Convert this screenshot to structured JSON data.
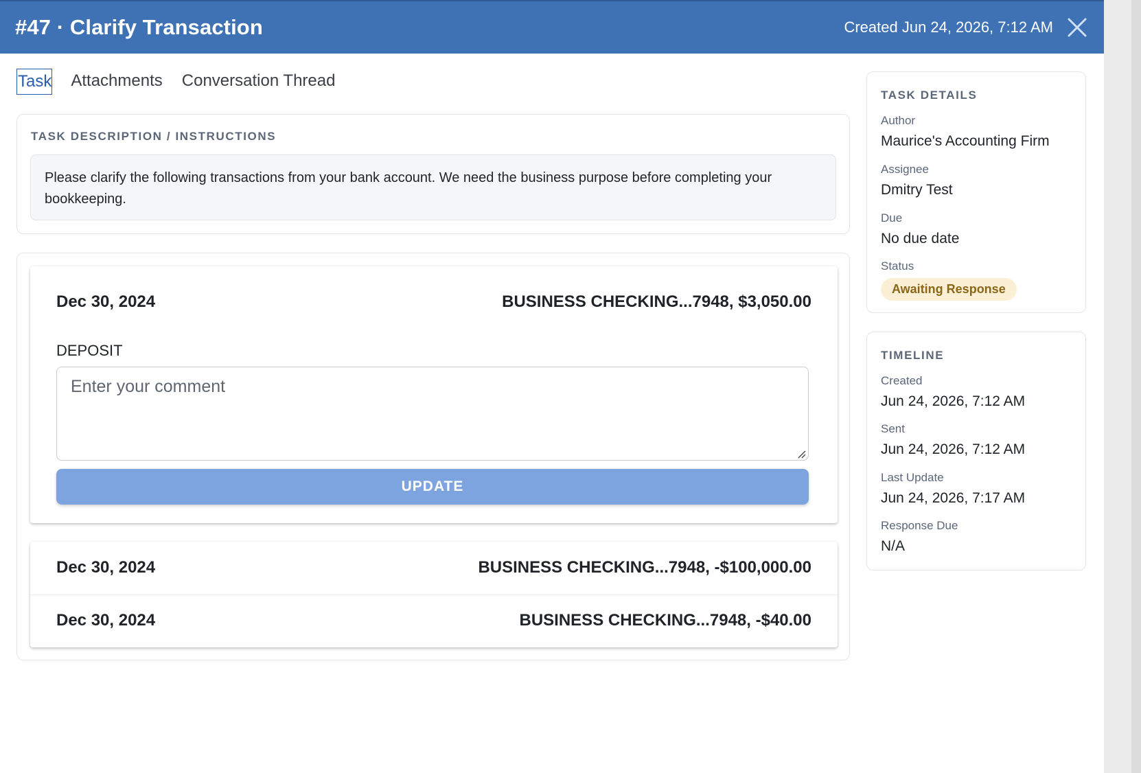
{
  "header": {
    "title": "#47 · Clarify Transaction",
    "created": "Created Jun 24, 2026, 7:12 AM"
  },
  "tabs": [
    {
      "label": "Task",
      "active": true
    },
    {
      "label": "Attachments",
      "active": false
    },
    {
      "label": "Conversation Thread",
      "active": false
    }
  ],
  "description": {
    "label": "TASK DESCRIPTION / INSTRUCTIONS",
    "text": "Please clarify the following transactions from your bank account. We need the business purpose before completing your bookkeeping."
  },
  "transactions": [
    {
      "date": "Dec 30, 2024",
      "account": "BUSINESS CHECKING...7948, $3,050.00",
      "type": "DEPOSIT",
      "comment_placeholder": "Enter your comment",
      "update_label": "UPDATE",
      "expanded": true
    },
    {
      "date": "Dec 30, 2024",
      "account": "BUSINESS CHECKING...7948, -$100,000.00",
      "expanded": false
    },
    {
      "date": "Dec 30, 2024",
      "account": "BUSINESS CHECKING...7948, -$40.00",
      "expanded": false
    }
  ],
  "details": {
    "label": "TASK DETAILS",
    "author_label": "Author",
    "author": "Maurice's Accounting Firm",
    "assignee_label": "Assignee",
    "assignee": "Dmitry Test",
    "due_label": "Due",
    "due": "No due date",
    "status_label": "Status",
    "status": "Awaiting Response"
  },
  "timeline": {
    "label": "TIMELINE",
    "created_label": "Created",
    "created": "Jun 24, 2026, 7:12 AM",
    "sent_label": "Sent",
    "sent": "Jun 24, 2026, 7:12 AM",
    "last_update_label": "Last Update",
    "last_update": "Jun 24, 2026, 7:17 AM",
    "response_due_label": "Response Due",
    "response_due": "N/A"
  },
  "colors": {
    "header_bg": "#3f72b4",
    "update_button": "#7ea4e0",
    "status_badge_bg": "#fbf0d6",
    "status_badge_text": "#8a6616"
  }
}
